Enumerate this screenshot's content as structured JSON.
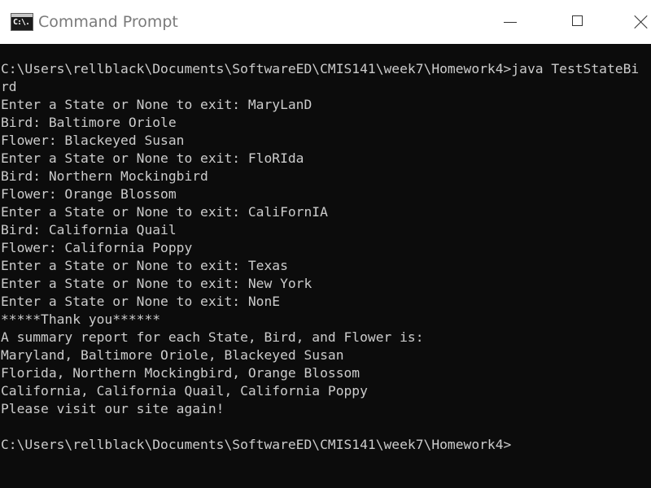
{
  "window": {
    "title": "Command Prompt",
    "icon": "cmd-icon",
    "icon_text": "C:\\.",
    "controls": {
      "minimize": "minimize-icon",
      "maximize": "maximize-icon",
      "close": "close-icon"
    }
  },
  "console": {
    "background": "#0c0c0c",
    "foreground": "#cccccc",
    "lines": [
      "C:\\Users\\rellblack\\Documents\\SoftwareED\\CMIS141\\week7\\Homework4>java TestStateBi",
      "rd",
      "Enter a State or None to exit: MaryLanD",
      "Bird: Baltimore Oriole",
      "Flower: Blackeyed Susan",
      "Enter a State or None to exit: FloRIda",
      "Bird: Northern Mockingbird",
      "Flower: Orange Blossom",
      "Enter a State or None to exit: CaliFornIA",
      "Bird: California Quail",
      "Flower: California Poppy",
      "Enter a State or None to exit: Texas",
      "Enter a State or None to exit: New York",
      "Enter a State or None to exit: NonE",
      "*****Thank you******",
      "A summary report for each State, Bird, and Flower is:",
      "Maryland, Baltimore Oriole, Blackeyed Susan",
      "Florida, Northern Mockingbird, Orange Blossom",
      "California, California Quail, California Poppy",
      "Please visit our site again!",
      "",
      "C:\\Users\\rellblack\\Documents\\SoftwareED\\CMIS141\\week7\\Homework4>"
    ]
  }
}
